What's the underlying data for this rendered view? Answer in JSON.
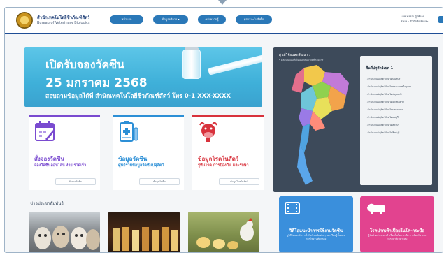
{
  "header": {
    "org_th": "สำนักเทคโนโลยีชีวภัณฑ์สัตว์",
    "org_en": "Bureau of Veterinary Biologics",
    "nav": [
      {
        "label": "หน้าแรก"
      },
      {
        "label": "ข้อมูลบริการ ▾"
      },
      {
        "label": "คลังความรู้"
      },
      {
        "label": "ดูสถานะใบสั่งซื้อ"
      }
    ],
    "user_line1": "นาย พรรณ ผู้ใช้งาน",
    "user_line2": "ส่งผล - สำนักจัดส่งและ"
  },
  "banner": {
    "line1": "เปิดรับจองวัคซีน",
    "line2": "25 มกราคม 2568",
    "line3": "สอบถามข้อมูลได้ที่ สำนักเทคโนโลยีชีวภัณฑ์สัตว์ โทร 0-1 XXX-XXXX"
  },
  "cards": [
    {
      "title": "สั่งจองวัคซีน",
      "subtitle": "จองวัคซีนออนไลน์ ง่าย รวดเร็ว",
      "button": "สั่งจองวัคซีน",
      "color": "#7a4bd0",
      "bar": "#7a4bd0"
    },
    {
      "title": "ข้อมูลวัคซีน",
      "subtitle": "ศูนย์รวมข้อมูลวัคซีนปศุสัตว์",
      "button": "ข้อมูลวัคซีน",
      "color": "#2c8fd6",
      "bar": "#2c8fd6"
    },
    {
      "title": "ข้อมูลโรคในสัตว์",
      "subtitle": "รู้ทันโรค การป้องกัน และรักษา",
      "button": "ข้อมูลโรคในสัตว์",
      "color": "#d8323c",
      "bar": "#d8323c"
    }
  ],
  "news": {
    "heading": "ข่าวประชาสัมพันธ์"
  },
  "map": {
    "title": "ศูนย์วิจัยและพัฒนา :",
    "note": "* คลิกบนแผนที่เพื่อเลือกศูนย์วิจัยที่ต้องการ",
    "list_title": "พื้นที่ปศุสัตว์เขต 1",
    "items": [
      "- สำนักงานปศุสัตว์จังหวัดนนทบุรี",
      "- สำนักงานปศุสัตว์จังหวัดพระนครศรีอยุธยา",
      "- สำนักงานปศุสัตว์จังหวัดปทุมธานี",
      "- สำนักงานปศุสัตว์จังหวัดฉะเชิงเทรา",
      "- สำนักงานปศุสัตว์จังหวัดนครนายก",
      "- สำนักงานปศุสัตว์จังหวัดลพบุรี",
      "- สำนักงานปศุสัตว์จังหวัดสระบุรี",
      "- สำนักงานปศุสัตว์จังหวัดสิงห์บุรี"
    ]
  },
  "tiles": [
    {
      "title": "วิดีโอแนะนำการใช้งานวัคซีน",
      "sub": "ดูวิดีโอแนะนำการใช้วัคซีนชนิดต่างๆ และเรียนรู้ขั้นตอนการใช้งานที่ถูกต้อง",
      "color": "#3a8fdc"
    },
    {
      "title": "โรคปากเท้าเปื่อยในโค-กระบือ",
      "sub": "รู้ทันโรคปากและเท้าเปื่อยในโค-กระบือ การป้องกัน และวิธีรักษาที่เหมาะสม",
      "color": "#e2438f"
    }
  ]
}
